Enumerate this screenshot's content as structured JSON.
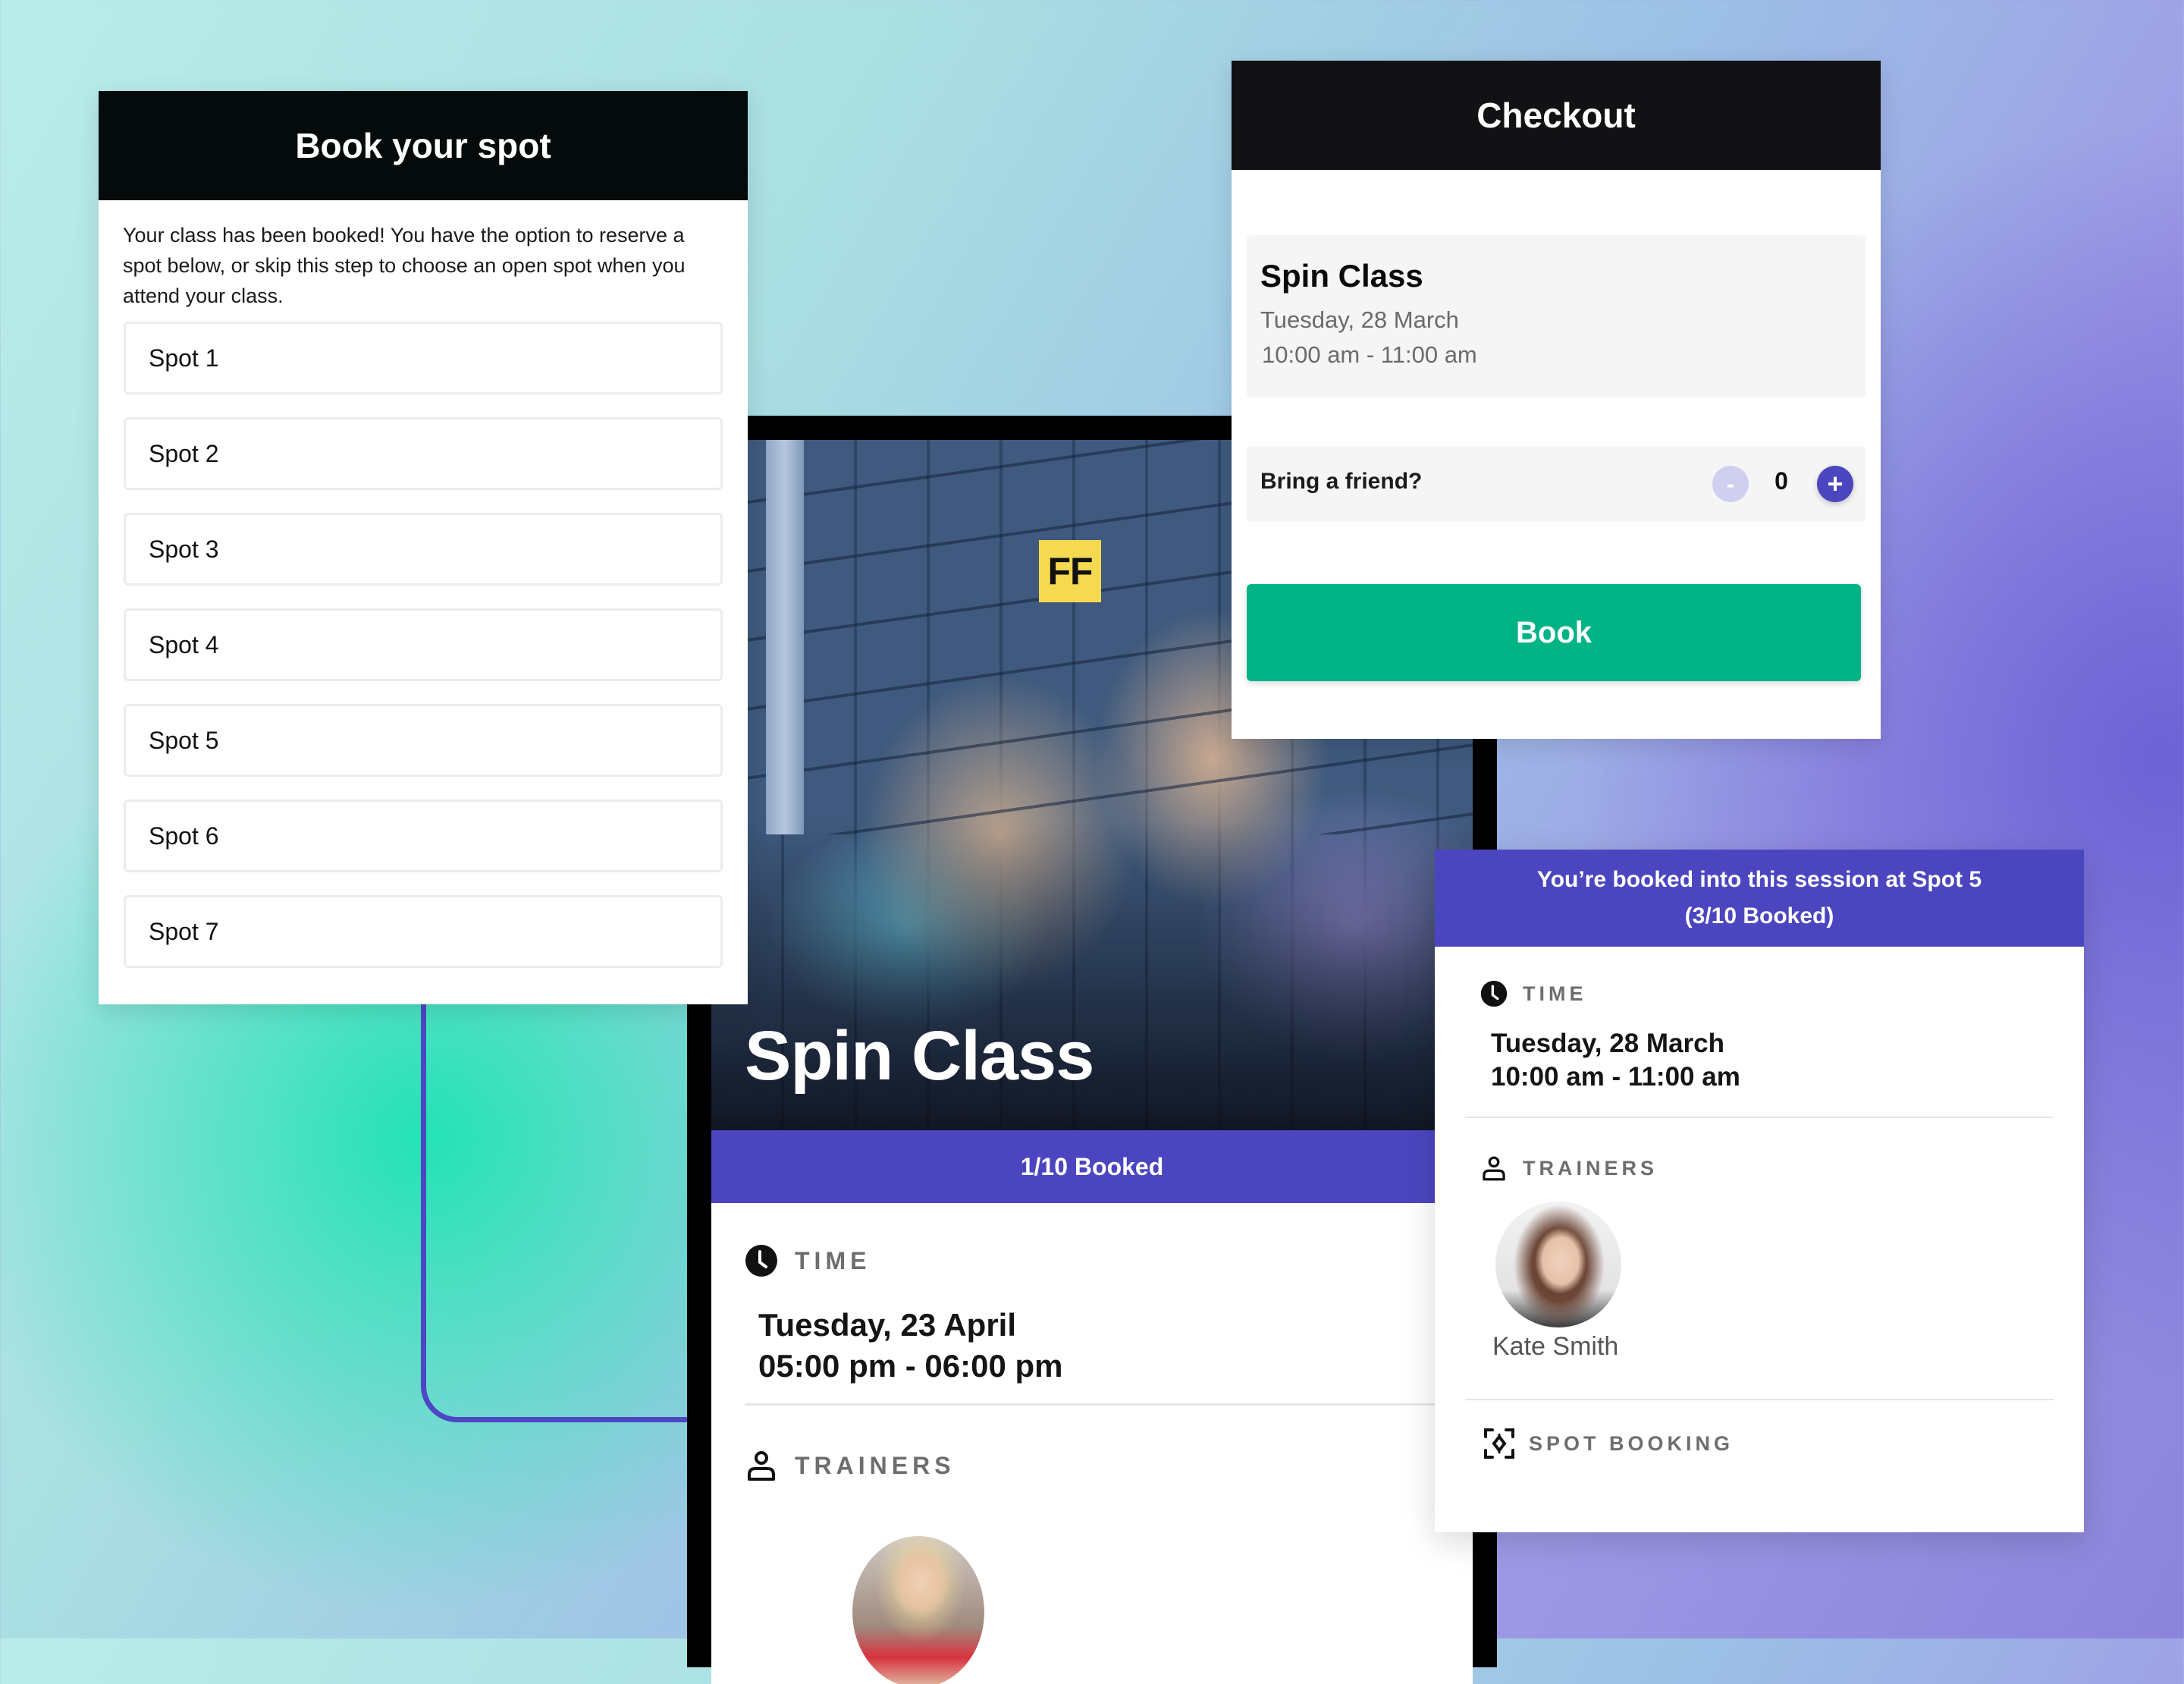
{
  "book_spot": {
    "title": "Book your spot",
    "description": "Your class has been booked! You have the option to reserve a spot below, or skip this step to choose an open spot when you attend your class.",
    "spots": [
      {
        "label": "Spot 1"
      },
      {
        "label": "Spot 2"
      },
      {
        "label": "Spot 3"
      },
      {
        "label": "Spot 4"
      },
      {
        "label": "Spot 5"
      },
      {
        "label": "Spot 6"
      },
      {
        "label": "Spot 7"
      }
    ]
  },
  "checkout": {
    "title": "Checkout",
    "class_name": "Spin Class",
    "date": "Tuesday, 28 March",
    "time": "10:00 am - 11:00 am",
    "bring_friend_label": "Bring a friend?",
    "friend_count": "0",
    "minus_label": "-",
    "plus_label": "+",
    "book_label": "Book"
  },
  "class_detail": {
    "logo_text": "FF",
    "title": "Spin Class",
    "booked_status": "1/10 Booked",
    "time_label": "TIME",
    "date": "Tuesday, 23 April",
    "time": "05:00 pm - 06:00 pm",
    "trainers_label": "TRAINERS"
  },
  "session": {
    "banner_line1": "You’re booked into this session at Spot 5",
    "banner_line2": "(3/10 Booked)",
    "time_label": "TIME",
    "date": "Tuesday, 28 March",
    "time": "10:00 am - 11:00 am",
    "trainers_label": "TRAINERS",
    "trainer_name": "Kate Smith",
    "spot_booking_label": "SPOT BOOKING"
  },
  "colors": {
    "accent_purple": "#4b46bf",
    "book_green": "#02b386",
    "logo_yellow": "#f5d94f",
    "header_black": "#050a0b"
  }
}
